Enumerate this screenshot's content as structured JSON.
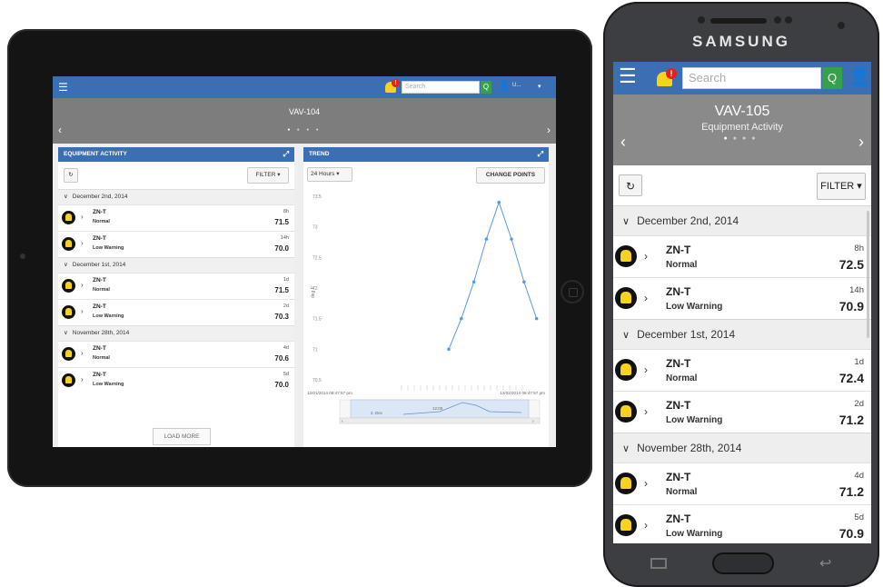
{
  "tablet": {
    "header": {
      "search_placeholder": "Search",
      "search_button": "Q",
      "user_name": "U...",
      "alert_badge": "!"
    },
    "title": "VAV-104",
    "left_panel": {
      "title": "EQUIPMENT ACTIVITY",
      "filter_label": "FILTER ▾",
      "refresh_label": "↻",
      "groups": [
        {
          "date": "December 2nd, 2014",
          "rows": [
            {
              "name": "ZN-T",
              "status": "Normal",
              "age": "8h",
              "value": "71.5"
            },
            {
              "name": "ZN-T",
              "status": "Low Warning",
              "age": "14h",
              "value": "70.0"
            }
          ]
        },
        {
          "date": "December 1st, 2014",
          "rows": [
            {
              "name": "ZN-T",
              "status": "Normal",
              "age": "1d",
              "value": "71.5"
            },
            {
              "name": "ZN-T",
              "status": "Low Warning",
              "age": "2d",
              "value": "70.3"
            }
          ]
        },
        {
          "date": "November 28th, 2014",
          "rows": [
            {
              "name": "ZN-T",
              "status": "Normal",
              "age": "4d",
              "value": "70.6"
            },
            {
              "name": "ZN-T",
              "status": "Low Warning",
              "age": "5d",
              "value": "70.0"
            }
          ]
        }
      ],
      "load_more": "LOAD MORE"
    },
    "right_panel": {
      "title": "TREND",
      "range_select": "24 Hours",
      "change_points": "CHANGE POINTS"
    }
  },
  "chart_data": {
    "type": "line",
    "ylabel": "deg F",
    "y_ticks": [
      "73.5",
      "73",
      "72.5",
      "72",
      "71.5",
      "71",
      "70.5"
    ],
    "ylim": [
      70.5,
      73.5
    ],
    "x_start_label": "12/01/2014 08:47:57 pm",
    "x_end_label": "12/02/2014 08:47:57 pm",
    "series": [
      {
        "x": [
          0,
          1,
          2,
          3,
          4,
          5,
          6,
          7
        ],
        "values": [
          71.0,
          71.5,
          72.1,
          72.8,
          73.4,
          72.8,
          72.1,
          71.5
        ]
      }
    ],
    "navigator_labels": [
      "2. Dec",
      "12:00"
    ]
  },
  "phone": {
    "brand": "SAMSUNG",
    "header": {
      "search_placeholder": "Search",
      "search_button": "Q",
      "alert_badge": "!"
    },
    "title": "VAV-105",
    "subtitle": "Equipment Activity",
    "filter_label": "FILTER ▾",
    "refresh_label": "↻",
    "groups": [
      {
        "date": "December 2nd, 2014",
        "rows": [
          {
            "name": "ZN-T",
            "status": "Normal",
            "age": "8h",
            "value": "72.5"
          },
          {
            "name": "ZN-T",
            "status": "Low Warning",
            "age": "14h",
            "value": "70.9"
          }
        ]
      },
      {
        "date": "December 1st, 2014",
        "rows": [
          {
            "name": "ZN-T",
            "status": "Normal",
            "age": "1d",
            "value": "72.4"
          },
          {
            "name": "ZN-T",
            "status": "Low Warning",
            "age": "2d",
            "value": "71.2"
          }
        ]
      },
      {
        "date": "November 28th, 2014",
        "rows": [
          {
            "name": "ZN-T",
            "status": "Normal",
            "age": "4d",
            "value": "71.2"
          },
          {
            "name": "ZN-T",
            "status": "Low Warning",
            "age": "5d",
            "value": "70.9"
          }
        ]
      }
    ]
  },
  "colors": {
    "accent": "#3a6fb4",
    "bell": "#f7d21f",
    "badge": "#e2231a",
    "search_button": "#36a14a",
    "title_bar": "#8a8a8a"
  }
}
